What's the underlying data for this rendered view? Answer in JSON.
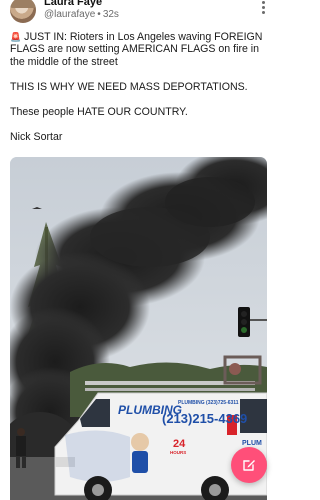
{
  "author": {
    "display_name": "Laura Faye",
    "handle": "@laurafaye",
    "separator": "•",
    "time_ago": "32s"
  },
  "post": {
    "siren_emoji": "🚨",
    "line1": "JUST IN: Rioters in Los Angeles waving FOREIGN FLAGS are now setting AMERICAN FLAGS on fire in the middle of the street",
    "line2": "THIS IS WHY WE NEED MASS DEPORTATIONS.",
    "line3": "These people HATE OUR COUNTRY.",
    "line4": "Nick Sortar"
  },
  "media": {
    "van_brand": "PLUMBING",
    "van_phone": "(213)215-4369",
    "van_small_text": "PLUMBING (323)725-6311",
    "van_number": "24",
    "van_number_sub": "HOURS",
    "van_side_label": "PLUM"
  },
  "colors": {
    "accent": "#ff4f79",
    "van_blue": "#1f4fa8",
    "van_red": "#d8232a",
    "smoke": "#2a2a2a"
  },
  "icons": {
    "more": "more-vertical-icon",
    "compose": "compose-icon"
  }
}
